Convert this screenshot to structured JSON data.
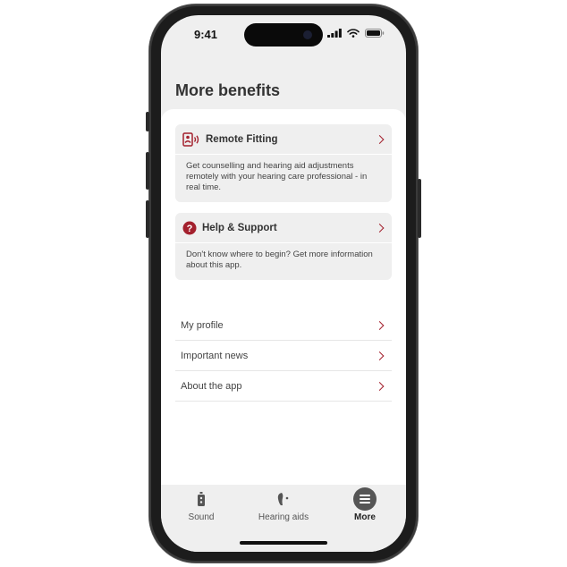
{
  "status": {
    "time": "9:41"
  },
  "page": {
    "title": "More benefits"
  },
  "cards": [
    {
      "title": "Remote Fitting",
      "icon": "remote-fitting-icon",
      "description": "Get counselling and hearing aid adjustments remotely with your hearing care professional - in real time."
    },
    {
      "title": "Help & Support",
      "icon": "help-icon",
      "description": "Don't know where to begin? Get more information about this app."
    }
  ],
  "menu": [
    {
      "label": "My profile"
    },
    {
      "label": "Important news"
    },
    {
      "label": "About the app"
    }
  ],
  "tabs": [
    {
      "label": "Sound",
      "icon": "sound-icon",
      "active": false
    },
    {
      "label": "Hearing aids",
      "icon": "hearing-aid-icon",
      "active": false
    },
    {
      "label": "More",
      "icon": "menu-icon",
      "active": true
    }
  ],
  "colors": {
    "accent": "#a3202d",
    "background": "#efefef",
    "card": "#efefef"
  }
}
